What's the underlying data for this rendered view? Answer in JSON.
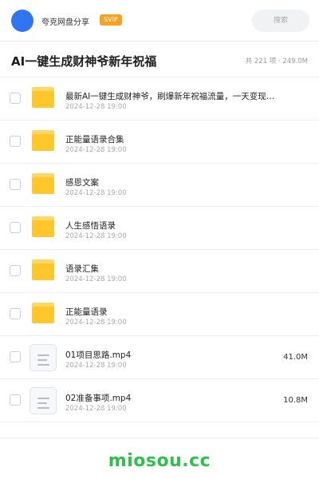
{
  "header": {
    "app_name": "夸克网盘分享",
    "badge": "SVIP",
    "search_placeholder": "搜索"
  },
  "title_bar": {
    "title": "AI一键生成财神爷新年祝福",
    "meta": "共 221 项 · 249.0M"
  },
  "items": [
    {
      "type": "folder",
      "name": "最新AI一键生成财神爷，刷爆新年祝福流量，一天变现…",
      "date": "2024-12-28 19:00",
      "size": ""
    },
    {
      "type": "folder",
      "name": "正能量语录合集",
      "date": "2024-12-28 19:00",
      "size": ""
    },
    {
      "type": "folder",
      "name": "感恩文案",
      "date": "2024-12-28 19:00",
      "size": ""
    },
    {
      "type": "folder",
      "name": "人生感悟语录",
      "date": "2024-12-28 19:00",
      "size": ""
    },
    {
      "type": "folder",
      "name": "语录汇集",
      "date": "2024-12-28 19:00",
      "size": ""
    },
    {
      "type": "folder",
      "name": "正能量语录",
      "date": "2024-12-28 19:00",
      "size": ""
    },
    {
      "type": "file",
      "name": "01项目思路.mp4",
      "date": "2024-12-28 19:00",
      "size": "41.0M"
    },
    {
      "type": "file",
      "name": "02准备事项.mp4",
      "date": "2024-12-28 19:00",
      "size": "10.8M"
    }
  ],
  "watermark": "miosou.cc",
  "colors": {
    "accent": "#2f74f2",
    "badge": "#f7a022",
    "folder": "#ffc72c",
    "watermark": "#2fbf4a"
  }
}
